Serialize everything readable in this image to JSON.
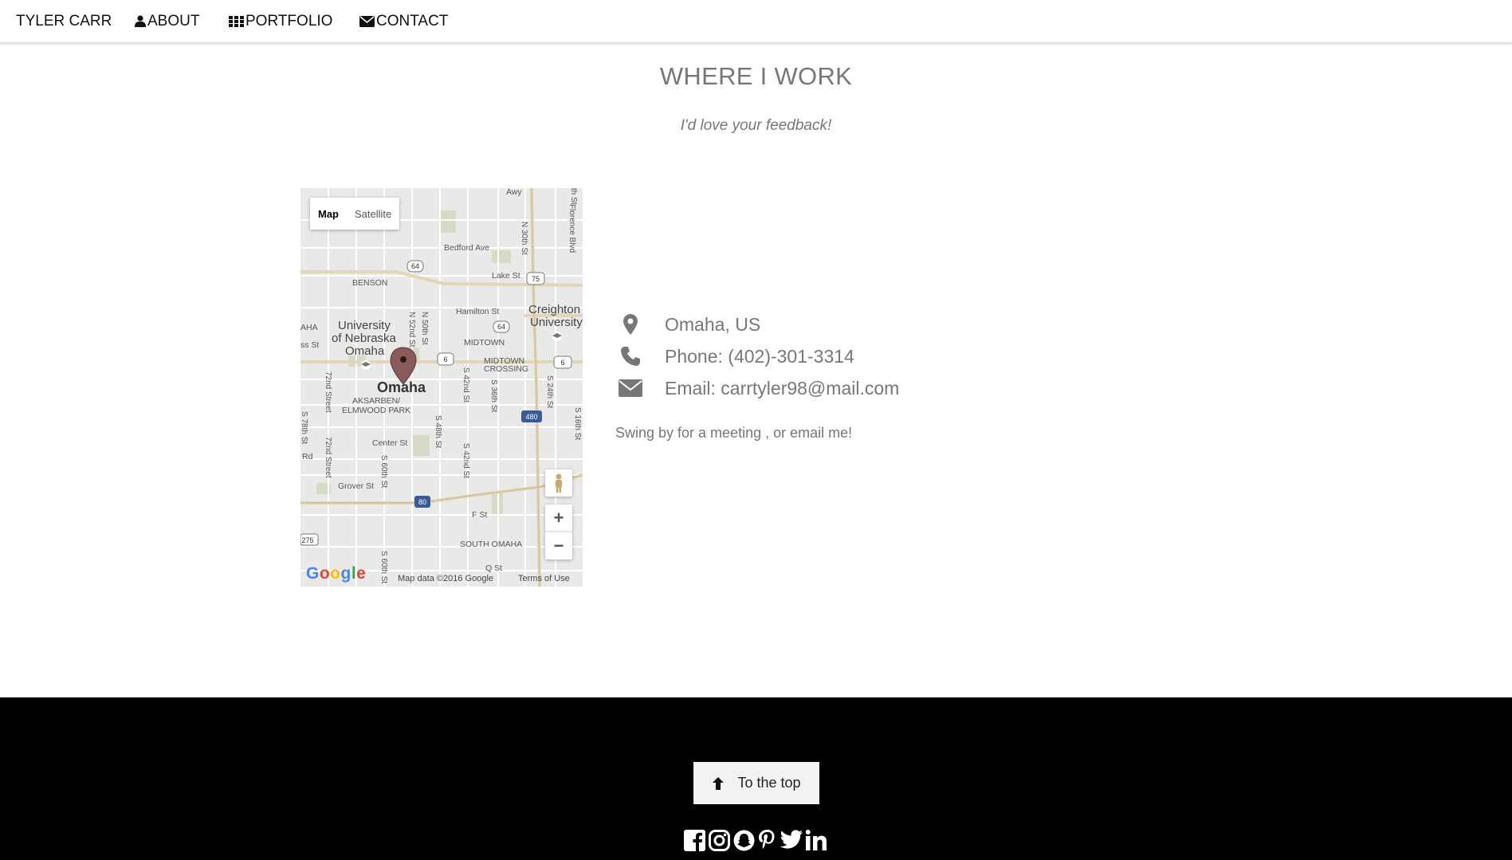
{
  "nav": {
    "brand": "TYLER CARR",
    "about": "ABOUT",
    "portfolio": "PORTFOLIO",
    "contact": "CONTACT"
  },
  "section": {
    "title": "WHERE I WORK",
    "subtitle": "I'd love your feedback!"
  },
  "map": {
    "type_map": "Map",
    "type_satellite": "Satellite",
    "zoom_in": "+",
    "zoom_out": "−",
    "google_logo": "Google",
    "data_credit": "Map data ©2016 Google",
    "terms": "Terms of Use",
    "city_label": "Omaha",
    "labels": {
      "bedford": "Bedford Ave",
      "benson": "BENSON",
      "lake": "Lake St",
      "hamilton": "Hamilton St",
      "creighton1": "Creighton",
      "creighton2": "University",
      "uno1": "University",
      "uno2": "of Nebraska",
      "uno3": "Omaha",
      "midtown": "MIDTOWN",
      "midtown_crossing1": "MIDTOWN",
      "midtown_crossing2": "CROSSING",
      "aksarben1": "AKSARBEN/",
      "aksarben2": "ELMWOOD PARK",
      "center": "Center St",
      "grover": "Grover St",
      "f": "F St",
      "south_omaha": "SOUTH OMAHA",
      "q": "Q St",
      "n30": "N 30th St",
      "florence": "Florence Blvd",
      "n52": "N 52nd St",
      "n50": "N 50th St",
      "s72a": "72nd Street",
      "s72b": "72nd Street",
      "s42a": "S 42nd St",
      "s36": "S 36th St",
      "s24": "S 24th St",
      "s16": "S 16th St",
      "s48": "S 48th St",
      "s42b": "S 42nd St",
      "s60a": "S 60th St",
      "s60b": "S 60th St",
      "s78": "S 78th St",
      "rd": "Rd",
      "aha": "AHA",
      "sst": "ss St",
      "wy": "Awy",
      "n": "th St",
      "hw64a": "64",
      "hw64b": "64",
      "hw75": "75",
      "hw6a": "6",
      "hw6b": "6",
      "i480": "480",
      "i80": "80",
      "i275": "275"
    }
  },
  "contact": {
    "location": "Omaha, US",
    "phone": "Phone: (402)-301-3314",
    "email": "Email: carrtyler98@mail.com",
    "note": "Swing by for a meeting , or email me!"
  },
  "footer": {
    "to_top": "To the top",
    "social": [
      "facebook-icon",
      "instagram-icon",
      "snapchat-icon",
      "pinterest-icon",
      "twitter-icon",
      "linkedin-icon"
    ]
  },
  "colors": {
    "text_gray": "#777777",
    "footer_bg": "#000000",
    "marker": "#8a5a5a"
  }
}
